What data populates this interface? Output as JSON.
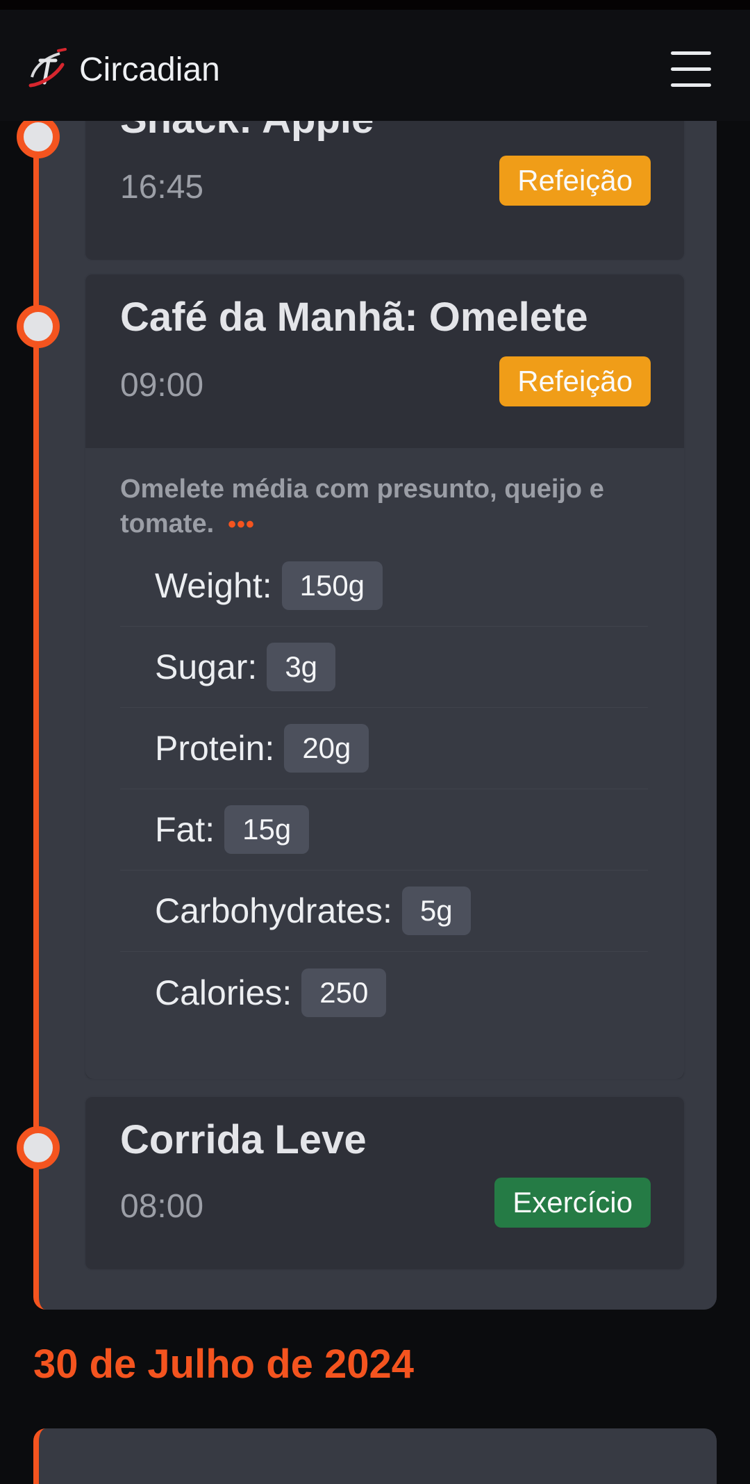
{
  "app": {
    "title": "Circadian",
    "logo_icon": "circadian-logo-icon",
    "menu_icon": "hamburger-menu-icon"
  },
  "colors": {
    "accent": "#f4541f",
    "meal_badge": "#f09d18",
    "exercise_badge": "#257b45",
    "card_bg": "#2e3038"
  },
  "timeline": {
    "events": [
      {
        "title": "Snack: Apple",
        "time": "16:45",
        "category": "Refeição"
      },
      {
        "title": "Café da Manhã: Omelete",
        "time": "09:00",
        "category": "Refeição",
        "description": "Omelete média com presunto, queijo e tomate.",
        "more_label": "•••",
        "nutrients": [
          {
            "label": "Weight:",
            "value": "150g"
          },
          {
            "label": "Sugar:",
            "value": "3g"
          },
          {
            "label": "Protein:",
            "value": "20g"
          },
          {
            "label": "Fat:",
            "value": "15g"
          },
          {
            "label": "Carbohydrates:",
            "value": "5g"
          },
          {
            "label": "Calories:",
            "value": "250"
          }
        ]
      },
      {
        "title": "Corrida Leve",
        "time": "08:00",
        "category": "Exercício"
      }
    ]
  },
  "next_day": {
    "date": "30 de Julho de 2024"
  }
}
